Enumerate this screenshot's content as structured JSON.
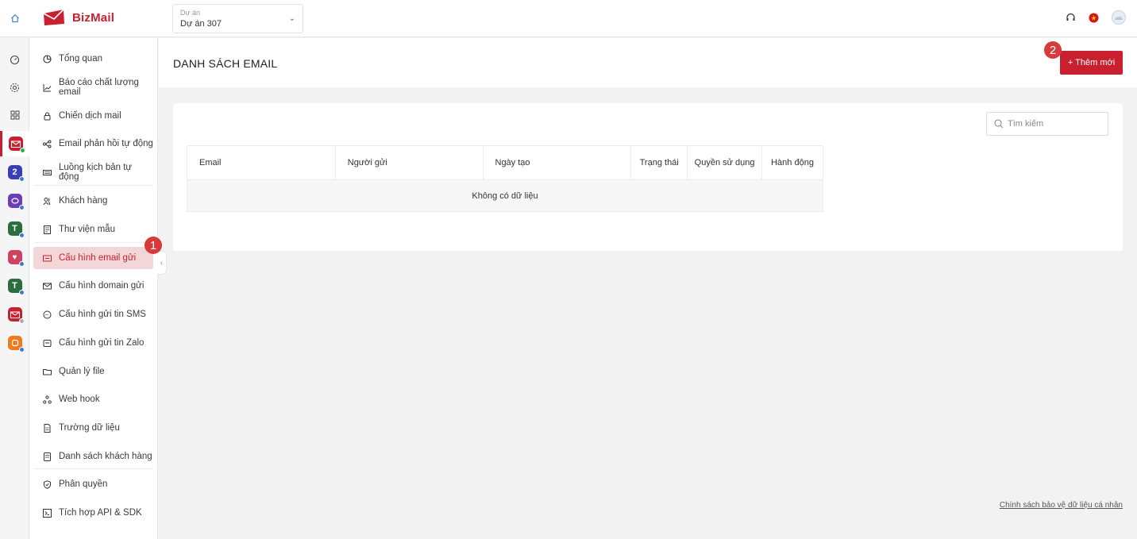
{
  "app": {
    "name_part1": "Biz",
    "name_part2": "Mail",
    "brand_color": "#c8202f"
  },
  "project": {
    "label": "Dự án",
    "value": "Dự án 307"
  },
  "header": {
    "icons": [
      "headset-icon",
      "vietnam-flag-icon",
      "user-avatar-icon"
    ]
  },
  "rail": {
    "items": [
      {
        "name": "dashboard-icon"
      },
      {
        "name": "settings-icon"
      },
      {
        "name": "apps-grid-icon"
      },
      {
        "name": "bizmail-app-icon",
        "color": "#c8202f",
        "active": true
      },
      {
        "name": "app-2-icon",
        "color": "#3b3fb5"
      },
      {
        "name": "app-3-icon",
        "color": "#6a3fb5"
      },
      {
        "name": "app-4-icon",
        "color": "#2a6e3f"
      },
      {
        "name": "app-5-icon",
        "color": "#d0435f"
      },
      {
        "name": "app-6-icon",
        "color": "#2a6e3f"
      },
      {
        "name": "app-7-icon",
        "color": "#c8202f"
      },
      {
        "name": "app-8-icon",
        "color": "#f07a1e"
      }
    ]
  },
  "sidebar": {
    "items": [
      {
        "label": "Tổng quan",
        "icon": "pie-chart-icon"
      },
      {
        "label": "Báo cáo chất lượng email",
        "icon": "line-chart-icon"
      },
      {
        "label": "Chiến dịch mail",
        "icon": "lock-icon"
      },
      {
        "label": "Email phản hồi tự động",
        "icon": "flow-icon"
      },
      {
        "label": "Luồng kịch bản tự động",
        "icon": "keyboard-icon"
      },
      {
        "label": "Khách hàng",
        "icon": "users-icon"
      },
      {
        "label": "Thư viện mẫu",
        "icon": "template-icon"
      },
      {
        "label": "Cấu hình email gửi",
        "icon": "mail-config-icon",
        "active": true
      },
      {
        "label": "Cấu hình domain gửi",
        "icon": "envelope-icon"
      },
      {
        "label": "Cấu hình gửi tin SMS",
        "icon": "chat-icon"
      },
      {
        "label": "Cấu hình gửi tin Zalo",
        "icon": "zalo-icon"
      },
      {
        "label": "Quản lý file",
        "icon": "folder-icon"
      },
      {
        "label": "Web hook",
        "icon": "webhook-icon"
      },
      {
        "label": "Trường dữ liệu",
        "icon": "field-icon"
      },
      {
        "label": "Danh sách khách hàng",
        "icon": "list-icon"
      },
      {
        "label": "Phân quyền",
        "icon": "shield-icon"
      },
      {
        "label": "Tích hợp API & SDK",
        "icon": "code-icon"
      }
    ]
  },
  "page": {
    "title": "DANH SÁCH EMAIL",
    "add_button": "+ Thêm mới",
    "search_placeholder": "Tìm kiếm"
  },
  "table": {
    "columns": [
      "Email",
      "Người gửi",
      "Ngày tạo",
      "Trạng thái",
      "Quyền sử dụng",
      "Hành động"
    ],
    "empty_text": "Không có dữ liệu"
  },
  "badges": {
    "sidebar_step": "1",
    "button_step": "2"
  },
  "footer": {
    "privacy_link": "Chính sách bảo vệ dữ liệu cá nhân"
  }
}
